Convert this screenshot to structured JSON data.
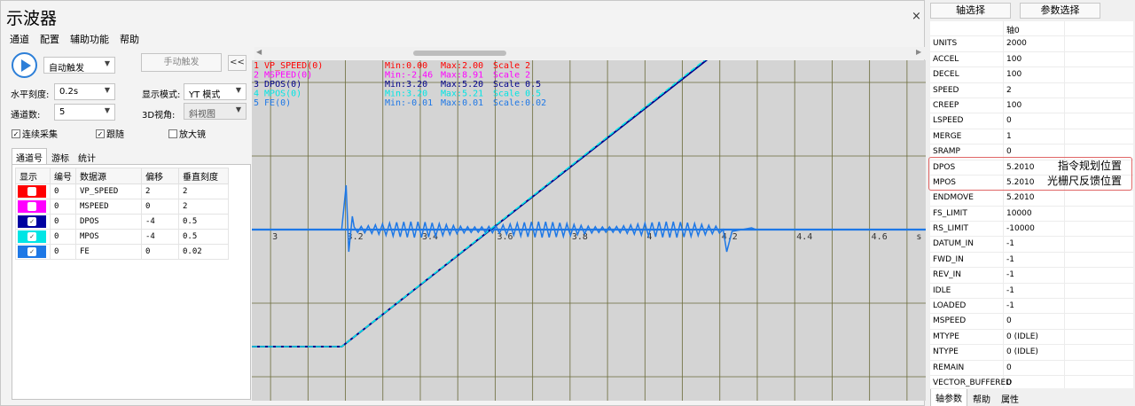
{
  "window": {
    "title": "示波器",
    "close_glyph": "×"
  },
  "menu": [
    "通道",
    "配置",
    "辅助功能",
    "帮助"
  ],
  "controls": {
    "trigger_mode": "自动触发",
    "manual_trigger": "手动触发",
    "collapse_glyph": "<<",
    "h_scale_label": "水平刻度:",
    "h_scale_value": "0.2s",
    "display_mode_label": "显示模式:",
    "display_mode_value": "YT 模式",
    "channels_label": "通道数:",
    "channels_value": "5",
    "view3d_label": "3D视角:",
    "view3d_value": "斜视图",
    "continuous": "连续采集",
    "follow": "跟随",
    "magnifier": "放大镜"
  },
  "tabs": [
    "通道号",
    "游标",
    "统计"
  ],
  "channel_table": {
    "headers": [
      "显示",
      "编号",
      "数据源",
      "偏移",
      "垂直刻度"
    ],
    "rows": [
      {
        "color": "#ff0000",
        "checked": false,
        "num": "0",
        "source": "VP_SPEED",
        "offset": "2",
        "scale": "2"
      },
      {
        "color": "#ff00ff",
        "checked": false,
        "num": "0",
        "source": "MSPEED",
        "offset": "0",
        "scale": "2"
      },
      {
        "color": "#0000a0",
        "checked": true,
        "num": "0",
        "source": "DPOS",
        "offset": "-4",
        "scale": "0.5"
      },
      {
        "color": "#00e5e5",
        "checked": true,
        "num": "0",
        "source": "MPOS",
        "offset": "-4",
        "scale": "0.5"
      },
      {
        "color": "#1e78e6",
        "checked": true,
        "num": "0",
        "source": "FE",
        "offset": "0",
        "scale": "0.02"
      }
    ]
  },
  "legend": [
    {
      "label": "1 VP_SPEED(0)",
      "min": "Min:0.00",
      "max": "Max:2.00",
      "scale": "Scale 2",
      "color": "#ff0000"
    },
    {
      "label": "2 MSPEED(0)",
      "min": "Min:-2.46",
      "max": "Max:8.91",
      "scale": "Scale 2",
      "color": "#ff00ff"
    },
    {
      "label": "3 DPOS(0)",
      "min": "Min:3.20",
      "max": "Max:5.20",
      "scale": "Scale 0.5",
      "color": "#00008b"
    },
    {
      "label": "4 MPOS(0)",
      "min": "Min:3.20",
      "max": "Max:5.21",
      "scale": "Scale 0.5",
      "color": "#00e5e5"
    },
    {
      "label": "5 FE(0)",
      "min": "Min:-0.01",
      "max": "Max:0.01",
      "scale": "Scale:0.02",
      "color": "#1e78e6"
    }
  ],
  "chart_data": {
    "type": "line",
    "x_tick_labels": [
      "3",
      "3.2",
      "3.4",
      "3.6",
      "3.8",
      "4",
      "4.2",
      "4.4",
      "4.6",
      "s"
    ],
    "x_range": [
      2.95,
      4.75
    ],
    "series": [
      {
        "name": "DPOS(0)",
        "color": "#00008b",
        "points": [
          [
            2.95,
            3.2
          ],
          [
            3.19,
            3.2
          ],
          [
            4.17,
            5.2
          ]
        ]
      },
      {
        "name": "MPOS(0)",
        "color": "#00e5e5",
        "points": [
          [
            2.95,
            3.2
          ],
          [
            3.19,
            3.2
          ],
          [
            4.17,
            5.21
          ]
        ]
      },
      {
        "name": "FE(0)",
        "color": "#1e78e6",
        "note_shape": "spike at 3.2, oscillation until 4.2, dip at 4.23, flat after"
      }
    ],
    "grid": true
  },
  "params": {
    "axis_button": "轴选择",
    "param_button": "参数选择",
    "column_header": "轴0",
    "rows": [
      [
        "UNITS",
        "2000"
      ],
      [
        "ACCEL",
        "100"
      ],
      [
        "DECEL",
        "100"
      ],
      [
        "SPEED",
        "2"
      ],
      [
        "CREEP",
        "100"
      ],
      [
        "LSPEED",
        "0"
      ],
      [
        "MERGE",
        "1"
      ],
      [
        "SRAMP",
        "0"
      ],
      [
        "DPOS",
        "5.2010"
      ],
      [
        "MPOS",
        "5.2010"
      ],
      [
        "ENDMOVE",
        "5.2010"
      ],
      [
        "FS_LIMIT",
        "10000"
      ],
      [
        "RS_LIMIT",
        "-10000"
      ],
      [
        "DATUM_IN",
        "-1"
      ],
      [
        "FWD_IN",
        "-1"
      ],
      [
        "REV_IN",
        "-1"
      ],
      [
        "IDLE",
        "-1"
      ],
      [
        "LOADED",
        "-1"
      ],
      [
        "MSPEED",
        "0"
      ],
      [
        "MTYPE",
        "0 (IDLE)"
      ],
      [
        "NTYPE",
        "0 (IDLE)"
      ],
      [
        "REMAIN",
        "0"
      ],
      [
        "VECTOR_BUFFERED",
        "0"
      ]
    ],
    "annotation1": "指令规划位置",
    "annotation2": "光栅尺反馈位置",
    "bottom_tabs": [
      "轴参数",
      "帮助",
      "属性"
    ]
  }
}
